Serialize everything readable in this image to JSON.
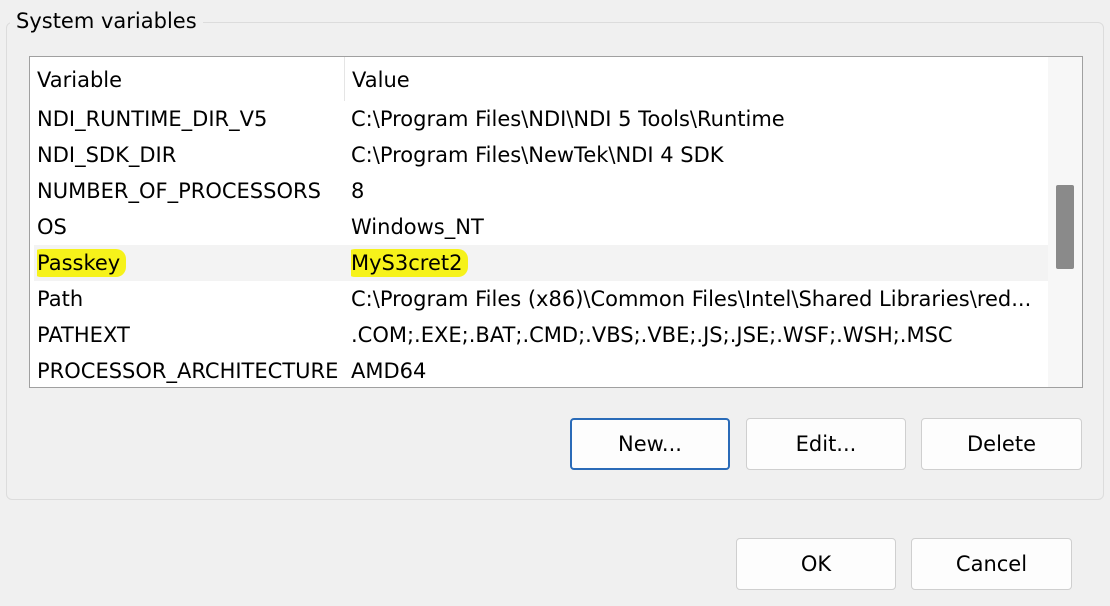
{
  "group": {
    "title": "System variables"
  },
  "list": {
    "columns": {
      "variable": "Variable",
      "value": "Value"
    },
    "rows": [
      {
        "variable": "NDI_RUNTIME_DIR_V5",
        "value": "C:\\Program Files\\NDI\\NDI 5 Tools\\Runtime"
      },
      {
        "variable": "NDI_SDK_DIR",
        "value": "C:\\Program Files\\NewTek\\NDI 4 SDK"
      },
      {
        "variable": "NUMBER_OF_PROCESSORS",
        "value": "8"
      },
      {
        "variable": "OS",
        "value": "Windows_NT"
      },
      {
        "variable": "Passkey",
        "value": "MyS3cret2",
        "selected": true,
        "highlighted": true
      },
      {
        "variable": "Path",
        "value": "C:\\Program Files (x86)\\Common Files\\Intel\\Shared Libraries\\red..."
      },
      {
        "variable": "PATHEXT",
        "value": ".COM;.EXE;.BAT;.CMD;.VBS;.VBE;.JS;.JSE;.WSF;.WSH;.MSC"
      },
      {
        "variable": "PROCESSOR_ARCHITECTURE",
        "value": "AMD64"
      }
    ]
  },
  "buttons": {
    "new": "New...",
    "edit": "Edit...",
    "delete": "Delete",
    "ok": "OK",
    "cancel": "Cancel"
  },
  "colors": {
    "highlight": "#f6f21a",
    "default_button_border": "#2a6bb8",
    "selected_row": "#f3f3f3"
  }
}
